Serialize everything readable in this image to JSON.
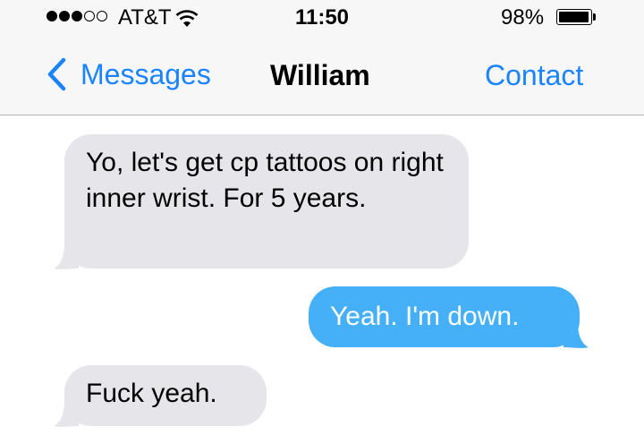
{
  "status_bar": {
    "signal_filled": 3,
    "signal_empty": 2,
    "carrier": "AT&T",
    "wifi_icon": "wifi-icon",
    "time": "11:50",
    "battery_percent_label": "98%",
    "battery_level": 0.98
  },
  "nav": {
    "back_icon": "chevron-left-icon",
    "back_label": "Messages",
    "title": "William",
    "contact_label": "Contact"
  },
  "colors": {
    "accent": "#1a84ff",
    "sent_bubble": "#45b0f8",
    "received_bubble": "#e5e5ea"
  },
  "messages": [
    {
      "direction": "received",
      "text": "Yo, let's get cp tattoos on right inner wrist. For 5 years."
    },
    {
      "direction": "sent",
      "text": "Yeah. I'm down."
    },
    {
      "direction": "received",
      "text": "Fuck yeah."
    }
  ]
}
